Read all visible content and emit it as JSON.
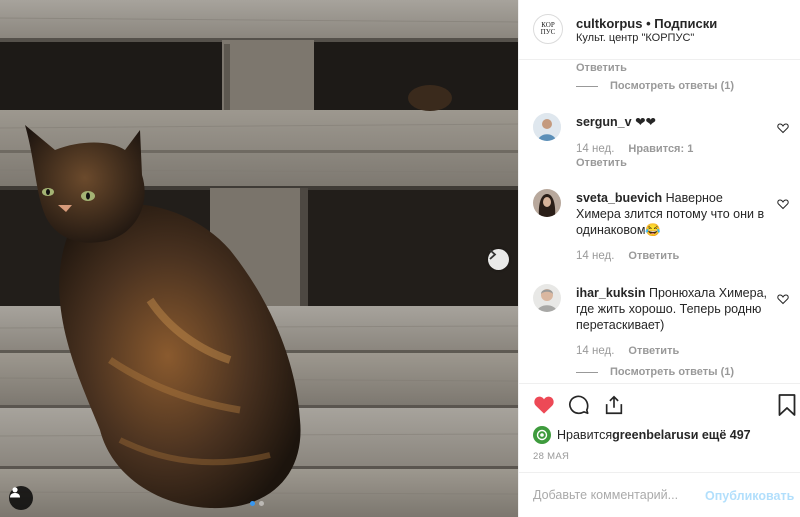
{
  "header": {
    "username": "cultkorpus",
    "separator": " • ",
    "follow_label": "Подписки",
    "location": "Культ. центр \"КОРПУС\"",
    "logo_text": "КОР ПУС"
  },
  "comments": {
    "top_reply_label": "Ответить",
    "top_view_replies": "Посмотреть ответы (1)",
    "items": [
      {
        "username": "sergun_v",
        "text": " ❤❤",
        "ago": "14 нед.",
        "likes": "Нравится: 1",
        "reply": "Ответить"
      },
      {
        "username": "sveta_buevich",
        "text": " Наверное Химера злится потому что они в одинаковом😂",
        "ago": "14 нед.",
        "reply": "Ответить"
      },
      {
        "username": "ihar_kuksin",
        "text": " Пронюхала Химера, где жить хорошо. Теперь родню перетаскивает)",
        "ago": "14 нед.",
        "reply": "Ответить",
        "view_replies": "Посмотреть ответы (1)"
      }
    ]
  },
  "likes": {
    "prefix": "Нравится ",
    "user": "greenbelarus",
    "suffix": " и ещё 497"
  },
  "date": "28 МАЯ",
  "add_comment": {
    "placeholder": "Добавьте комментарий...",
    "publish_label": "Опубликовать"
  },
  "carousel": {
    "current": 1,
    "total": 2
  },
  "colors": {
    "heart": "#ed4956",
    "link": "#3897f0",
    "publish_disabled": "#b2dffc"
  }
}
